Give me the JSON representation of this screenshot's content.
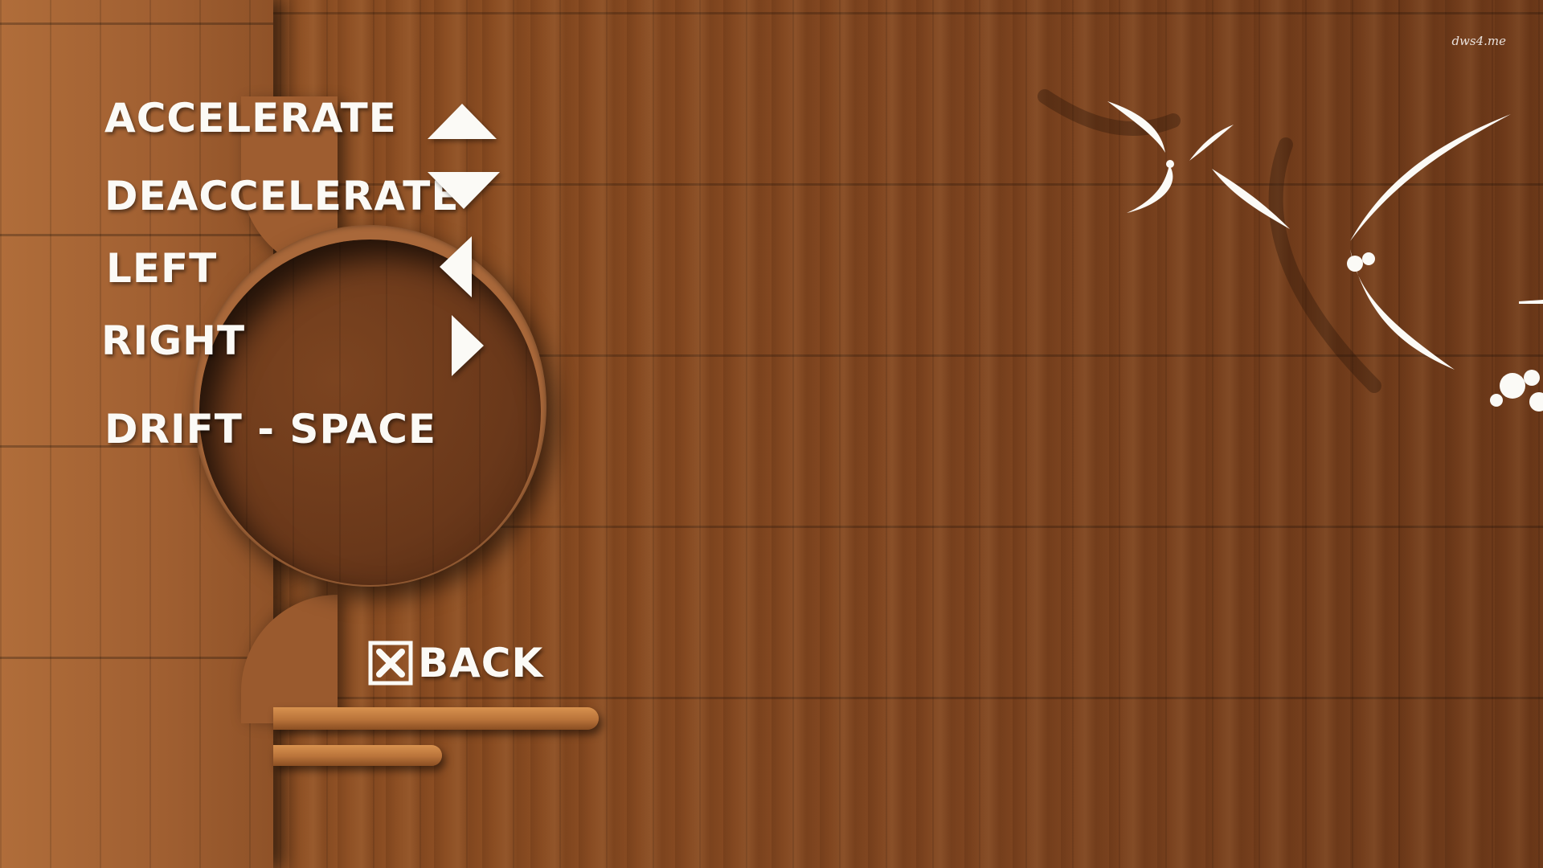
{
  "controls": {
    "accelerate": {
      "label": "ACCELERATE",
      "icon": "arrow-up-icon"
    },
    "deaccelerate": {
      "label": "DEACCELERATE",
      "icon": "arrow-down-icon"
    },
    "left": {
      "label": "LEFT",
      "icon": "arrow-left-icon"
    },
    "right": {
      "label": "RIGHT",
      "icon": "arrow-right-icon"
    },
    "drift": {
      "label": "DRIFT - SPACE"
    }
  },
  "back_button": {
    "label": "BACK",
    "icon": "close-box-icon"
  },
  "watermark": "dws4.me",
  "colors": {
    "text": "#fbfaf6",
    "wood_dark": "#6e3a1a",
    "wood_light": "#b06d3a"
  }
}
